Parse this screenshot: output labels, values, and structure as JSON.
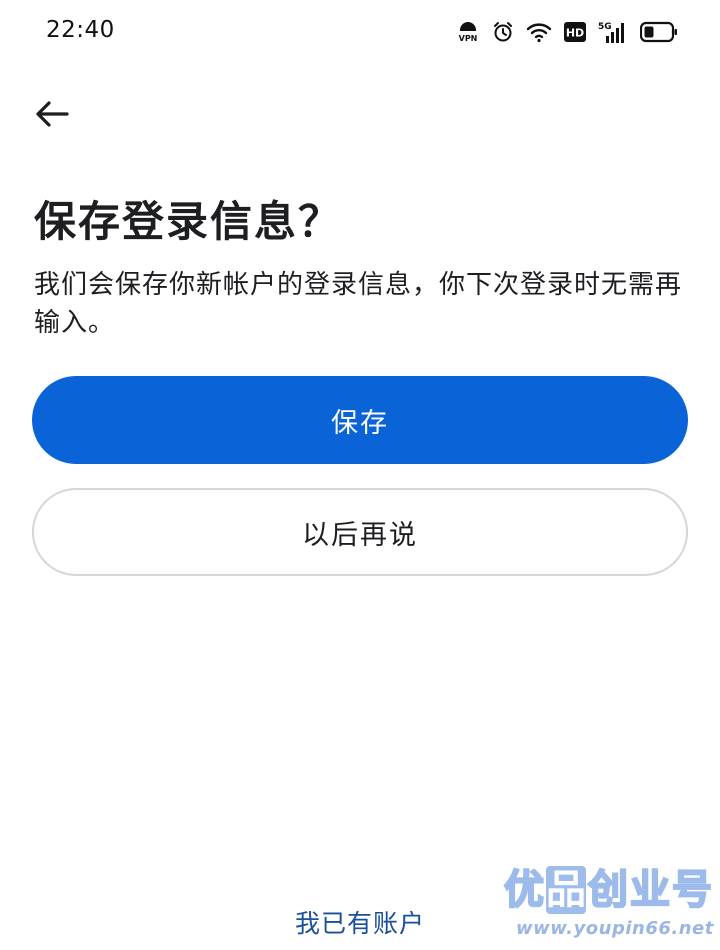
{
  "status_bar": {
    "time": "22:40",
    "vpn_label": "VPN",
    "hd_label": "HD",
    "network_label": "5G"
  },
  "header": {
    "back_icon": "arrow-left-icon"
  },
  "main": {
    "title": "保存登录信息？",
    "description": "我们会保存你新帐户的登录信息，你下次登录时无需再输入。",
    "save_button": "保存",
    "later_button": "以后再说"
  },
  "footer": {
    "have_account_link": "我已有账户"
  },
  "watermark": {
    "url": "www.youpin66.net"
  },
  "colors": {
    "primary": "#0b63d8",
    "link": "#1a4f9a",
    "text": "#1c1e21",
    "border": "#d3d6db"
  }
}
